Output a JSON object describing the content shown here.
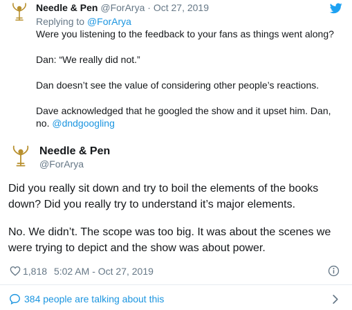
{
  "reply_tweet": {
    "author_name": "Needle & Pen",
    "handle": "@ForArya",
    "separator": "·",
    "date": "Oct 27, 2019",
    "replying_prefix": "Replying to",
    "replying_to": "@ForArya",
    "paragraphs": [
      "Were you listening to the feedback to your fans as things went along?",
      "Dan: “We really did not.”",
      "Dan doesn’t see the value of considering other people’s reactions.",
      "Dave acknowledged that he googled the show and it upset him. Dan,"
    ],
    "last_line_text": "no.",
    "mention": "@dndgoogling"
  },
  "main_tweet": {
    "author_name": "Needle & Pen",
    "handle": "@ForArya",
    "paragraph1_line1": "Did you really sit down and try to boil the elements of the books",
    "paragraph1_line2": "down? Did you really try to understand it’s major elements.",
    "paragraph2_line1": "No. We didn’t. The scope was too big. It was about the scenes we",
    "paragraph2_line2": "were trying to depict and the show was about power.",
    "likes": "1,818",
    "timestamp": "5:02 AM - Oct 27, 2019"
  },
  "footer": {
    "talking_text": "384 people are talking about this"
  },
  "colors": {
    "twitter_blue": "#1da1f2",
    "link": "#1b95e0",
    "muted": "#657786",
    "border": "#e6ecf0",
    "avatar_gold": "#b8902f"
  },
  "icons": [
    "twitter-bird-icon",
    "emmy-avatar-icon",
    "heart-icon",
    "info-icon",
    "speech-bubble-icon",
    "chevron-right-icon"
  ]
}
